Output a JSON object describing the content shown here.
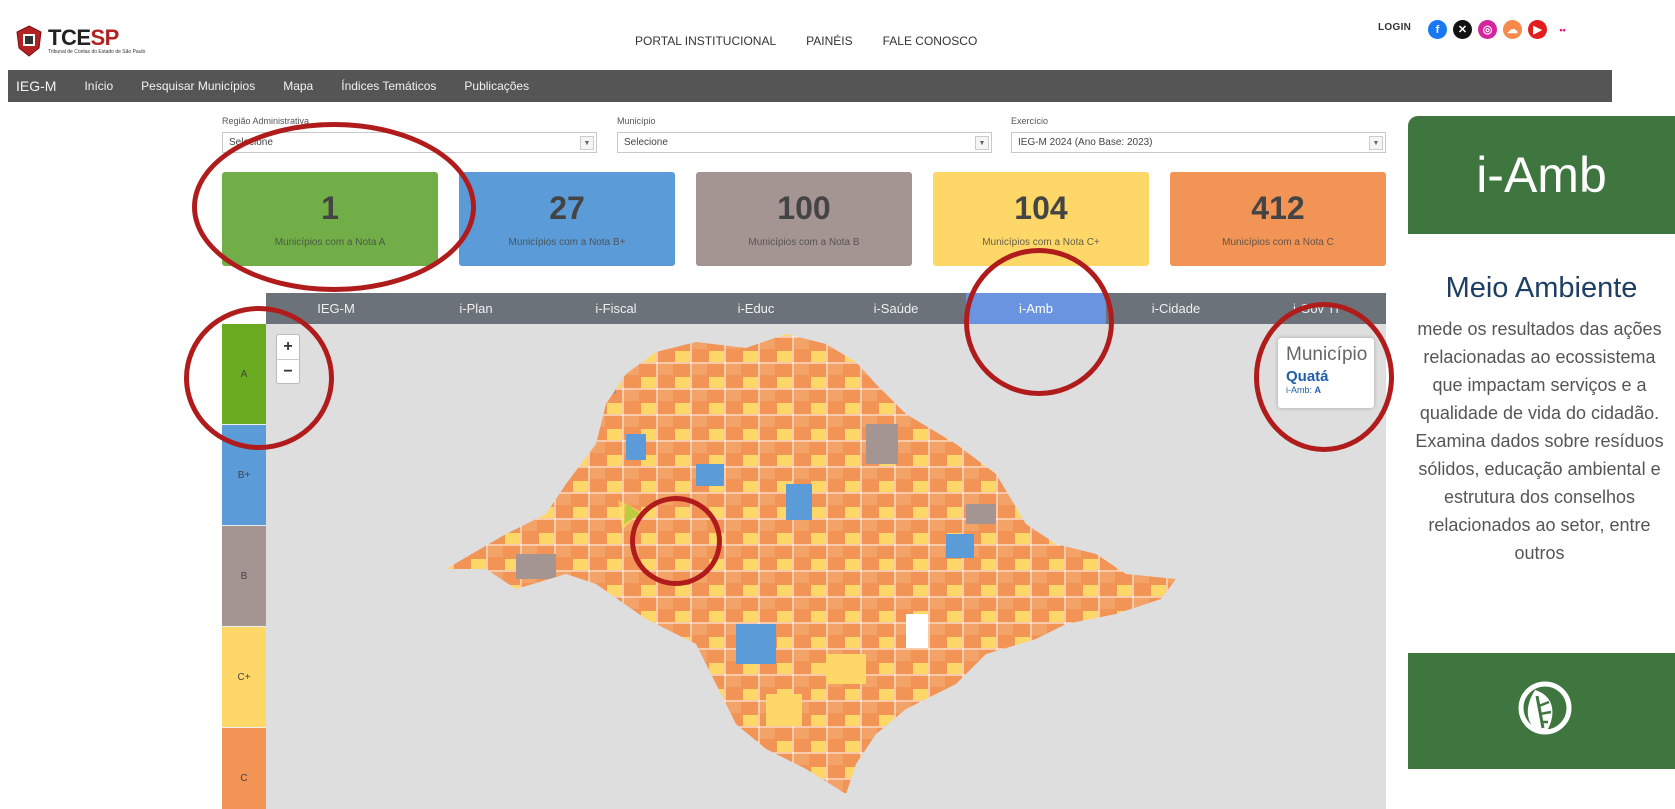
{
  "header": {
    "brand": "TCE",
    "brand_accent": "SP",
    "brand_sub": "Tribunal de Contas do Estado de São Paulo",
    "top_links": [
      "PORTAL INSTITUCIONAL",
      "PAINÉIS",
      "FALE CONOSCO"
    ],
    "login": "LOGIN",
    "social_icons": [
      "facebook-icon",
      "x-icon",
      "instagram-icon",
      "soundcloud-icon",
      "youtube-icon",
      "flickr-icon"
    ]
  },
  "nav": {
    "items": [
      "IEG-M",
      "Início",
      "Pesquisar Municípios",
      "Mapa",
      "Índices Temáticos",
      "Publicações"
    ]
  },
  "filters": {
    "regiao": {
      "label": "Região Administrativa",
      "value": "Selecione"
    },
    "municipio": {
      "label": "Município",
      "value": "Selecione"
    },
    "exercicio": {
      "label": "Exercício",
      "value": "IEG-M 2024 (Ano Base: 2023)"
    }
  },
  "cards": [
    {
      "value": "1",
      "label": "Municípios com a Nota A",
      "color": "#72ae48"
    },
    {
      "value": "27",
      "label": "Municípios com a Nota B+",
      "color": "#5a9bd8"
    },
    {
      "value": "100",
      "label": "Municípios com a Nota B",
      "color": "#a59592"
    },
    {
      "value": "104",
      "label": "Municípios com a Nota C+",
      "color": "#fdd868"
    },
    {
      "value": "412",
      "label": "Municípios com a Nota C",
      "color": "#f19455"
    }
  ],
  "tabs": {
    "items": [
      "IEG-M",
      "i-Plan",
      "i-Fiscal",
      "i-Educ",
      "i-Saúde",
      "i-Amb",
      "i-Cidade",
      "i-Gov TI"
    ],
    "active": "i-Amb"
  },
  "legend": [
    {
      "label": "A",
      "color": "#6aab21"
    },
    {
      "label": "B+",
      "color": "#5a9bd8"
    },
    {
      "label": "B",
      "color": "#a59592"
    },
    {
      "label": "C+",
      "color": "#fdd868"
    },
    {
      "label": "C",
      "color": "#f19455"
    }
  ],
  "map": {
    "zoom_in": "+",
    "zoom_out": "−",
    "infobox": {
      "title": "Município",
      "name": "Quatá",
      "index_label": "i-Amb:",
      "index_value": "A"
    }
  },
  "panel": {
    "heading": "i-Amb",
    "title": "Meio Ambiente",
    "description": "mede os resultados das ações relacionadas ao ecossistema que impactam serviços e a qualidade de vida do cidadão. Examina dados sobre resíduos sólidos, educação ambiental e estrutura dos conselhos relacionados ao setor, entre outros",
    "icon": "leaf-globe-icon",
    "accent": "#3f7640"
  }
}
